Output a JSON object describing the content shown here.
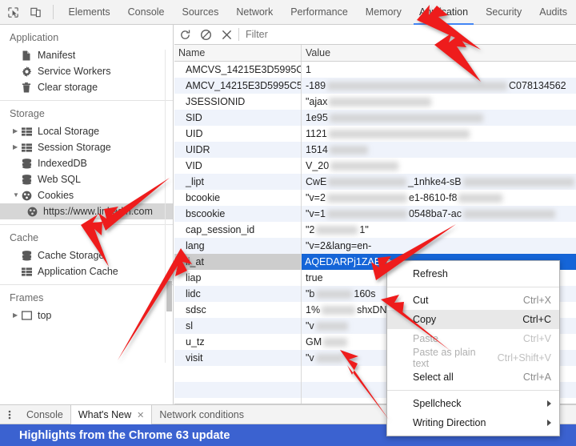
{
  "toolbar": {
    "inspect_icon": "inspect-cursor-icon",
    "device_icon": "device-toolbar-icon",
    "tabs": [
      {
        "label": "Elements",
        "active": false
      },
      {
        "label": "Console",
        "active": false
      },
      {
        "label": "Sources",
        "active": false
      },
      {
        "label": "Network",
        "active": false
      },
      {
        "label": "Performance",
        "active": false
      },
      {
        "label": "Memory",
        "active": false
      },
      {
        "label": "Application",
        "active": true
      },
      {
        "label": "Security",
        "active": false
      },
      {
        "label": "Audits",
        "active": false
      }
    ]
  },
  "sidebar": {
    "sections": [
      {
        "title": "Application",
        "items": [
          {
            "label": "Manifest",
            "icon": "document-icon",
            "twisty": "",
            "selected": false
          },
          {
            "label": "Service Workers",
            "icon": "gear-icon",
            "twisty": "",
            "selected": false
          },
          {
            "label": "Clear storage",
            "icon": "trash-icon",
            "twisty": "",
            "selected": false
          }
        ]
      },
      {
        "title": "Storage",
        "items": [
          {
            "label": "Local Storage",
            "icon": "table-icon",
            "twisty": "▶",
            "selected": false
          },
          {
            "label": "Session Storage",
            "icon": "table-icon",
            "twisty": "▶",
            "selected": false
          },
          {
            "label": "IndexedDB",
            "icon": "database-icon",
            "twisty": "",
            "selected": false
          },
          {
            "label": "Web SQL",
            "icon": "database-icon",
            "twisty": "",
            "selected": false
          },
          {
            "label": "Cookies",
            "icon": "cookie-icon",
            "twisty": "▼",
            "selected": false
          },
          {
            "label": "https://www.linkedin.com",
            "icon": "cookie-icon",
            "twisty": "",
            "selected": true,
            "child": true
          }
        ]
      },
      {
        "title": "Cache",
        "items": [
          {
            "label": "Cache Storage",
            "icon": "database-icon",
            "twisty": "",
            "selected": false
          },
          {
            "label": "Application Cache",
            "icon": "table-icon",
            "twisty": "",
            "selected": false
          }
        ]
      },
      {
        "title": "Frames",
        "items": [
          {
            "label": "top",
            "icon": "frame-icon",
            "twisty": "▶",
            "selected": false
          }
        ]
      }
    ]
  },
  "filterbar": {
    "refresh_icon": "refresh-icon",
    "clear_icon": "block-icon",
    "delete_icon": "close-icon",
    "filter_placeholder": "Filter",
    "filter_value": ""
  },
  "table": {
    "columns": [
      "Name",
      "Value"
    ],
    "rows": [
      {
        "name": "AMCVS_14215E3D5995C...",
        "value": "1",
        "redacted": false,
        "selected": false
      },
      {
        "name": "AMCV_14215E3D5995C5...",
        "value": "-189",
        "value_tail": "C078134562",
        "redacted": true,
        "selected": false
      },
      {
        "name": "JSESSIONID",
        "value": "\"ajax",
        "redacted": true,
        "selected": false
      },
      {
        "name": "SID",
        "value": "1e95",
        "redacted": true,
        "selected": false
      },
      {
        "name": "UID",
        "value": "1121",
        "redacted": true,
        "selected": false
      },
      {
        "name": "UIDR",
        "value": "1514",
        "redacted": true,
        "selected": false
      },
      {
        "name": "VID",
        "value": "V_20",
        "redacted": true,
        "selected": false
      },
      {
        "name": "_lipt",
        "value": "CwE",
        "value_mid": "_1nhke4-sB",
        "redacted": true,
        "selected": false
      },
      {
        "name": "bcookie",
        "value": "\"v=2",
        "value_mid": "e1-8610-f8",
        "redacted": true,
        "selected": false
      },
      {
        "name": "bscookie",
        "value": "\"v=1",
        "value_mid": "0548ba7-ac",
        "redacted": true,
        "selected": false
      },
      {
        "name": "cap_session_id",
        "value": "\"2",
        "value_mid": "1\"",
        "redacted": true,
        "selected": false
      },
      {
        "name": "lang",
        "value": "\"v=2&lang=en-",
        "redacted": true,
        "selected": false
      },
      {
        "name": "li_at",
        "value": "AQEDARPj1ZABya",
        "redacted": true,
        "selected": true
      },
      {
        "name": "liap",
        "value": "true",
        "redacted": false,
        "selected": false
      },
      {
        "name": "lidc",
        "value": "\"b",
        "value_mid": "160s",
        "redacted": true,
        "selected": false
      },
      {
        "name": "sdsc",
        "value": "1%",
        "value_mid": "shxDN",
        "redacted": true,
        "selected": false
      },
      {
        "name": "sl",
        "value": "\"v",
        "redacted": true,
        "selected": false
      },
      {
        "name": "u_tz",
        "value": "GM",
        "redacted": true,
        "selected": false
      },
      {
        "name": "visit",
        "value": "\"v",
        "redacted": true,
        "selected": false
      }
    ]
  },
  "context_menu": {
    "items": [
      {
        "label": "Refresh",
        "shortcut": "",
        "disabled": false,
        "highlighted": false,
        "submenu": false
      },
      {
        "separator": true
      },
      {
        "label": "Cut",
        "shortcut": "Ctrl+X",
        "disabled": false,
        "highlighted": false,
        "submenu": false
      },
      {
        "label": "Copy",
        "shortcut": "Ctrl+C",
        "disabled": false,
        "highlighted": true,
        "submenu": false
      },
      {
        "label": "Paste",
        "shortcut": "Ctrl+V",
        "disabled": true,
        "highlighted": false,
        "submenu": false
      },
      {
        "label": "Paste as plain text",
        "shortcut": "Ctrl+Shift+V",
        "disabled": true,
        "highlighted": false,
        "submenu": false
      },
      {
        "label": "Select all",
        "shortcut": "Ctrl+A",
        "disabled": false,
        "highlighted": false,
        "submenu": false
      },
      {
        "separator": true
      },
      {
        "label": "Spellcheck",
        "shortcut": "",
        "disabled": false,
        "highlighted": false,
        "submenu": true
      },
      {
        "label": "Writing Direction",
        "shortcut": "",
        "disabled": false,
        "highlighted": false,
        "submenu": true
      }
    ]
  },
  "drawer": {
    "menu_icon": "kebab-menu-icon",
    "tabs": [
      {
        "label": "Console",
        "active": false,
        "closable": false
      },
      {
        "label": "What's New",
        "active": true,
        "closable": true
      },
      {
        "label": "Network conditions",
        "active": false,
        "closable": false
      }
    ],
    "close_glyph": "✕",
    "banner_text": "Highlights from the Chrome 63 update",
    "banner_color": "#3b62d0"
  },
  "annotations": {
    "arrow_color": "#ee1c1c",
    "arrows": [
      {
        "name": "arrow-to-application-tab"
      },
      {
        "name": "arrow-to-value-column"
      },
      {
        "name": "arrow-to-cookies"
      },
      {
        "name": "arrow-to-linkedin-origin"
      },
      {
        "name": "arrow-to-li-at-row"
      },
      {
        "name": "arrow-to-li-at-value"
      },
      {
        "name": "arrow-to-copy-menu-item"
      },
      {
        "name": "arrow-to-drawer"
      }
    ]
  }
}
